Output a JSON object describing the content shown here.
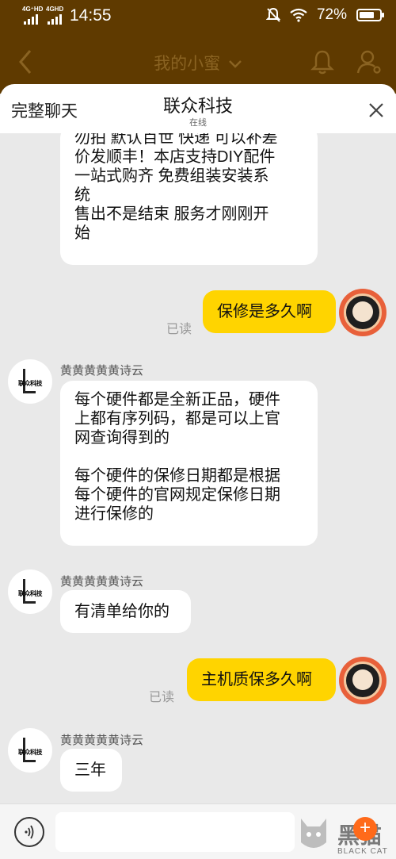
{
  "status_bar": {
    "net1": "4G⁺HD",
    "net2": "4GHD",
    "time": "14:55",
    "battery": "72%"
  },
  "header": {
    "title": "我的小蜜",
    "back_icon": "chevron-left-icon",
    "bell_icon": "bell-icon",
    "user_icon": "user-icon"
  },
  "sheet": {
    "full_chat_label": "完整聊天",
    "shop_name": "联众科技",
    "shop_status": "在线",
    "close_icon": "close-icon"
  },
  "messages": [
    {
      "type": "in",
      "text": "勿拍 默认百世 快递 可以补差\n价发顺丰！本店支持DIY配件\n一站式购齐 免费组装安装系\n统\n售出不是结束 服务才刚刚开\n始"
    },
    {
      "type": "out",
      "text": "保修是多久啊",
      "read": "已读"
    },
    {
      "type": "in",
      "sender": "黄黄黄黄黄诗云",
      "text": "每个硬件都是全新正品，硬件\n上都有序列码，都是可以上官\n网查询得到的\n\n每个硬件的保修日期都是根据\n每个硬件的官网规定保修日期\n进行保修的"
    },
    {
      "type": "in",
      "sender": "黄黄黄黄黄诗云",
      "text": "有清单给你的"
    },
    {
      "type": "out",
      "text": "主机质保多久啊",
      "read": "已读"
    },
    {
      "type": "in",
      "sender": "黄黄黄黄黄诗云",
      "text": "三年"
    }
  ],
  "shop_avatar_text": "联众科技",
  "input_bar": {
    "voice_icon": "voice-icon",
    "plus": "+"
  },
  "watermark": {
    "logo": "黑猫",
    "en": "BLACK CAT"
  },
  "colors": {
    "header_bg": "#5f3a00",
    "out_bubble": "#ffd400",
    "in_bubble": "#ffffff",
    "chat_bg": "#e9e9e9"
  }
}
